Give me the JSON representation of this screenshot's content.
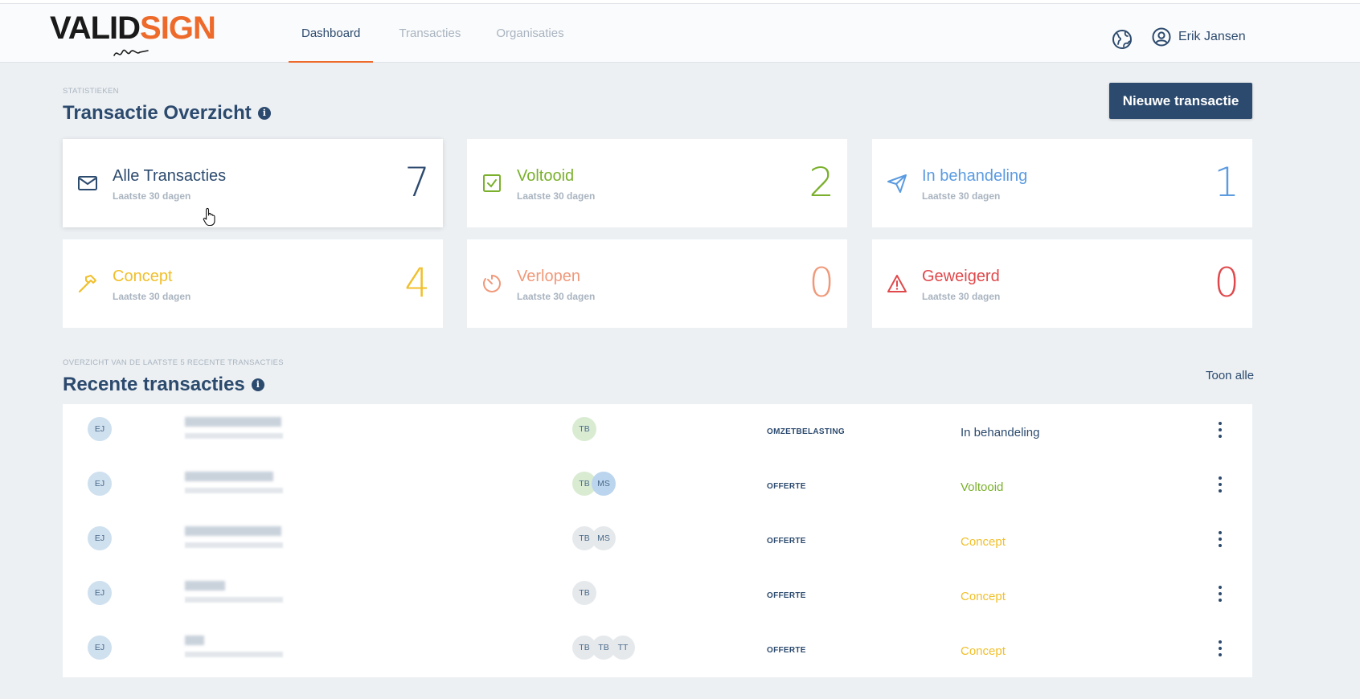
{
  "brand": {
    "part1": "VALID",
    "part2": "SIGN"
  },
  "nav": {
    "dashboard": "Dashboard",
    "transacties": "Transacties",
    "organisaties": "Organisaties"
  },
  "user": {
    "name": "Erik Jansen"
  },
  "stats": {
    "eyebrow": "STATISTIEKEN",
    "title": "Transactie Overzicht",
    "new_button": "Nieuwe transactie",
    "cards": [
      {
        "title": "Alle Transacties",
        "subtitle": "Laatste 30 dagen",
        "count": "7",
        "icon": "mail-icon",
        "color": "#2c4a6e"
      },
      {
        "title": "Voltooid",
        "subtitle": "Laatste 30 dagen",
        "count": "2",
        "icon": "check-square-icon",
        "color": "#7ab02c"
      },
      {
        "title": "In behandeling",
        "subtitle": "Laatste 30 dagen",
        "count": "1",
        "icon": "send-icon",
        "color": "#5b9be0"
      },
      {
        "title": "Concept",
        "subtitle": "Laatste 30 dagen",
        "count": "4",
        "icon": "hammer-icon",
        "color": "#f1bf2a"
      },
      {
        "title": "Verlopen",
        "subtitle": "Laatste 30 dagen",
        "count": "0",
        "icon": "timer-icon",
        "color": "#f0997a"
      },
      {
        "title": "Geweigerd",
        "subtitle": "Laatste 30 dagen",
        "count": "0",
        "icon": "warning-icon",
        "color": "#e0484b"
      }
    ]
  },
  "recent": {
    "eyebrow": "OVERZICHT VAN DE LAATSTE 5 RECENTE TRANSACTIES",
    "title": "Recente transacties",
    "show_all": "Toon alle",
    "rows": [
      {
        "owner": "EJ",
        "signers": [
          "TB"
        ],
        "type": "OMZETBELASTING",
        "status": "In behandeling",
        "status_color": "#2c4a6e"
      },
      {
        "owner": "EJ",
        "signers": [
          "TB",
          "MS"
        ],
        "type": "OFFERTE",
        "status": "Voltooid",
        "status_color": "#7ab02c"
      },
      {
        "owner": "EJ",
        "signers": [
          "TB",
          "MS"
        ],
        "type": "OFFERTE",
        "status": "Concept",
        "status_color": "#f1bf2a"
      },
      {
        "owner": "EJ",
        "signers": [
          "TB"
        ],
        "type": "OFFERTE",
        "status": "Concept",
        "status_color": "#f1bf2a"
      },
      {
        "owner": "EJ",
        "signers": [
          "TB",
          "TB",
          "TT"
        ],
        "type": "OFFERTE",
        "status": "Concept",
        "status_color": "#f1bf2a"
      }
    ]
  }
}
